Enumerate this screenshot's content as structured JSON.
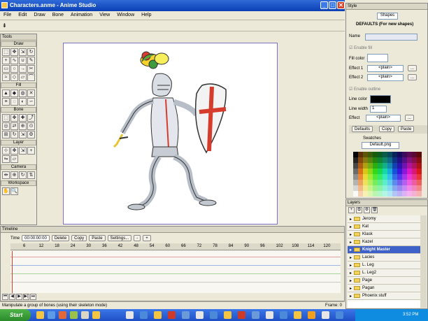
{
  "app": {
    "title": "Characters.anme - Anime Studio"
  },
  "menu": [
    "File",
    "Edit",
    "Draw",
    "Bone",
    "Animation",
    "View",
    "Window",
    "Help"
  ],
  "tools": {
    "header": "Tools",
    "sections": {
      "draw": "Draw",
      "fill": "Fill",
      "bone": "Bone",
      "layer": "Layer",
      "camera": "Camera",
      "workspace": "Workspace"
    }
  },
  "style": {
    "header": "Style",
    "mode": "Shapes",
    "defaults": "DEFAULTS (For new shapes)",
    "name_label": "Name",
    "enable_fill": "Enable fill",
    "fill_color": "Fill color",
    "effect1": "Effect 1",
    "effect2": "Effect 2",
    "plain": "<plain>",
    "enable_outline": "Enable outline",
    "line_color": "Line color",
    "line_width_label": "Line width",
    "line_width": "1",
    "effect": "Effect",
    "defaults_btn": "Defaults",
    "copy_btn": "Copy",
    "paste_btn": "Paste",
    "swatches": "Swatches",
    "swatch_set": "Default.png",
    "more": "...",
    "colors": {
      "fill": "#ffffff",
      "line": "#000000",
      "accent": "#3d61c8"
    }
  },
  "layers": {
    "header": "Layers",
    "items": [
      "Jeromy",
      "Kat",
      "Klask",
      "Kazel",
      "Knight Master",
      "Lacies",
      "L. Leg",
      "L. Leg2",
      "Page",
      "Pagan",
      "Phoenix stuff"
    ],
    "selected": "Knight Master"
  },
  "timeline": {
    "header": "Timeline",
    "time_label": "Time",
    "time": "00:00:00:00",
    "buttons": [
      "Delete",
      "Copy",
      "Paste",
      "Settings..."
    ],
    "ticks": [
      "6",
      "12",
      "18",
      "24",
      "30",
      "36",
      "42",
      "48",
      "54",
      "60",
      "66",
      "72",
      "78",
      "84",
      "90",
      "96",
      "102",
      "108",
      "114",
      "120"
    ]
  },
  "status": {
    "message": "Manipulate a group of bones (using their skeleton mode)",
    "frame": "Frame: 0"
  },
  "taskbar": {
    "start": "Start",
    "time": "3:52 PM"
  }
}
